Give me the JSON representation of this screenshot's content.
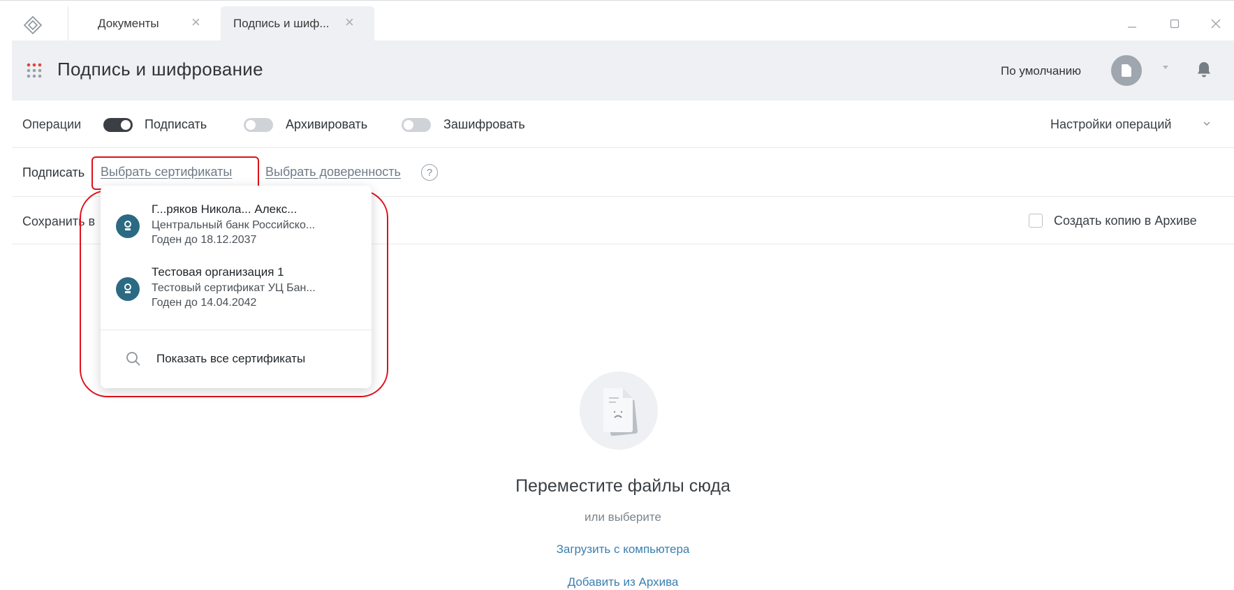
{
  "tabs": [
    {
      "label": "Документы"
    },
    {
      "label": "Подпись и шиф..."
    }
  ],
  "header": {
    "title": "Подпись и шифрование",
    "profile_label": "По умолчанию"
  },
  "operations": {
    "label": "Операции",
    "toggles": [
      {
        "label": "Подписать",
        "on": true
      },
      {
        "label": "Архивировать",
        "on": false
      },
      {
        "label": "Зашифровать",
        "on": false
      }
    ],
    "settings_label": "Настройки операций"
  },
  "sign": {
    "label": "Подписать",
    "select_certificates": "Выбрать сертификаты",
    "select_power_of_attorney": "Выбрать доверенность",
    "help": "?"
  },
  "save": {
    "label": "Сохранить в",
    "archive_copy_label": "Создать копию в Архиве"
  },
  "dropdown": {
    "certificates": [
      {
        "name": "Г...ряков Никола... Алекс...",
        "org": "Центральный банк Российско...",
        "valid": "Годен до 18.12.2037"
      },
      {
        "name": "Тестовая организация 1",
        "org": "Тестовый сертификат УЦ Бан...",
        "valid": "Годен до 14.04.2042"
      }
    ],
    "show_all": "Показать все сертификаты"
  },
  "empty_state": {
    "title": "Переместите файлы сюда",
    "subtitle": "или выберите",
    "upload_link": "Загрузить с компьютера",
    "archive_link": "Добавить из Архива"
  },
  "colors": {
    "header_bg": "#eef0f3",
    "toggle_on": "#3b3f44",
    "toggle_off": "#cfd3d7",
    "cert_icon": "#2b6a82",
    "link_blue": "#3b7fb0",
    "highlight": "#e0101a"
  }
}
